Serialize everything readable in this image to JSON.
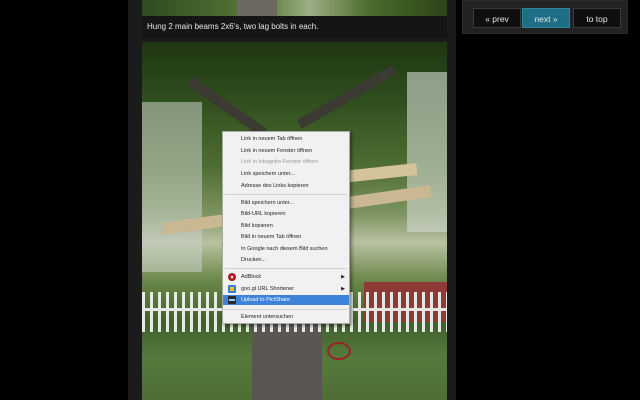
{
  "caption": "Hung 2 main beams 2x6's, two lag bolts in each.",
  "nav": {
    "prev": "« prev",
    "next": "next »",
    "top": "to top",
    "accent_color": "#1f6d86"
  },
  "context_menu": {
    "items": [
      {
        "label": "Link in neuem Tab öffnen"
      },
      {
        "label": "Link in neuem Fenster öffnen"
      },
      {
        "label": "Link in Inkognito-Fenster öffnen",
        "disabled": true
      },
      {
        "label": "Link speichern unter..."
      },
      {
        "label": "Adresse des Links kopieren"
      },
      {
        "label": "Bild speichern unter..."
      },
      {
        "label": "Bild-URL kopieren"
      },
      {
        "label": "Bild kopieren"
      },
      {
        "label": "Bild in neuem Tab öffnen"
      },
      {
        "label": "In Google nach diesem Bild suchen"
      },
      {
        "label": "Drucken..."
      },
      {
        "label": "AdBlock",
        "icon": "adblock-icon",
        "submenu": true
      },
      {
        "label": "goo.gl URL Shortener",
        "icon": "googl-icon",
        "submenu": true
      },
      {
        "label": "Upload to PictShare",
        "icon": "pictshare-icon",
        "highlighted": true
      },
      {
        "label": "Element untersuchen"
      }
    ],
    "highlight_color": "#3c83d9"
  }
}
